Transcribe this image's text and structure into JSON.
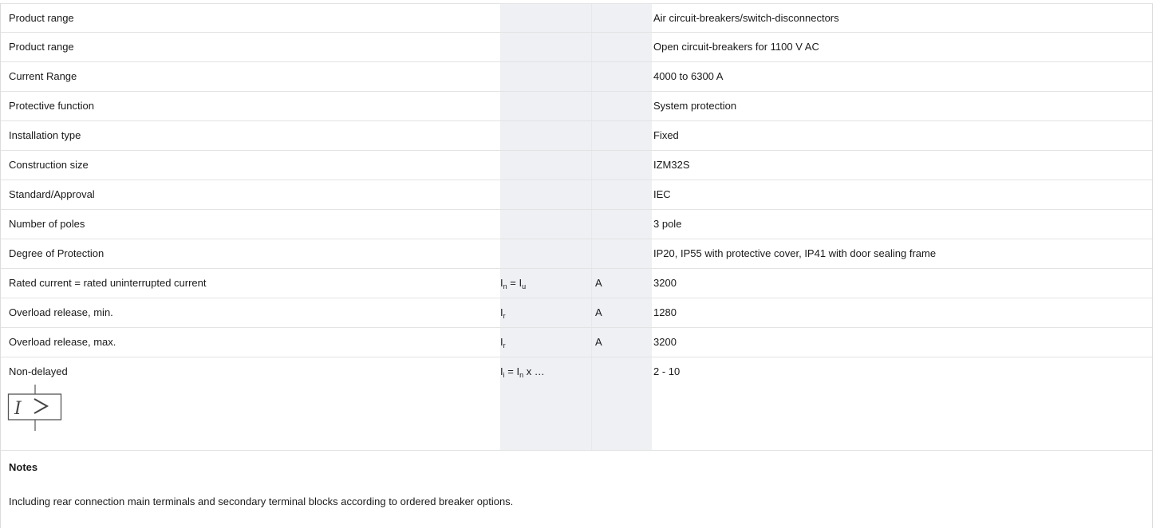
{
  "rows": [
    {
      "label": "Product range",
      "value": "Air circuit-breakers/switch-disconnectors"
    },
    {
      "label": "Product range",
      "value": "Open circuit-breakers for 1100 V AC"
    },
    {
      "label": "Current Range",
      "value": "4000 to 6300 A"
    },
    {
      "label": "Protective function",
      "value": "System protection"
    },
    {
      "label": "Installation type",
      "value": "Fixed"
    },
    {
      "label": "Construction size",
      "value": "IZM32S"
    },
    {
      "label": "Standard/Approval",
      "value": "IEC"
    },
    {
      "label": "Number of poles",
      "value": "3 pole"
    },
    {
      "label": "Degree of Protection",
      "value": "IP20, IP55 with protective cover, IP41 with door sealing frame"
    },
    {
      "label": "Rated current = rated uninterrupted current",
      "sym_base": "I",
      "sym_sub": "n",
      "sym_mid": " = I",
      "sym_sub2": "u",
      "sym_tail": "",
      "unit": "A",
      "value": "3200"
    },
    {
      "label": "Overload release, min.",
      "sym_base": "I",
      "sym_sub": "r",
      "unit": "A",
      "value": "1280"
    },
    {
      "label": "Overload release, max.",
      "sym_base": "I",
      "sym_sub": "r",
      "unit": "A",
      "value": "3200"
    },
    {
      "label": "Non-delayed",
      "sym_base": "I",
      "sym_sub": "i",
      "sym_mid": " = I",
      "sym_sub2": "n",
      "sym_tail": " x …",
      "unit": "",
      "value": "2 - 10",
      "icon": "overcurrent-release-symbol-icon",
      "icon_text": "I>"
    }
  ],
  "notes": {
    "heading": "Notes",
    "text": "Including rear connection main terminals and secondary terminal blocks according to ordered breaker options."
  }
}
